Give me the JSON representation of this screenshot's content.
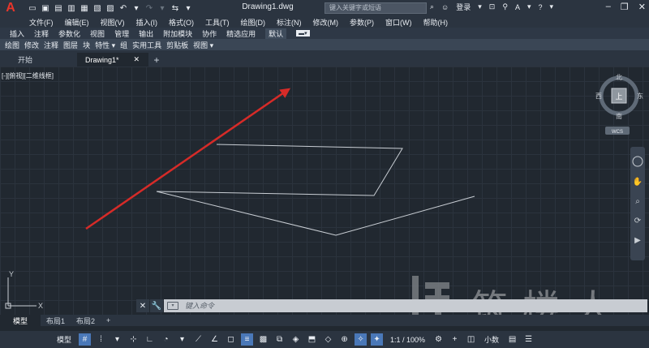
{
  "app": {
    "logo": "A",
    "document_title": "Drawing1.dwg"
  },
  "search": {
    "placeholder": "键入关键字或短语"
  },
  "account": {
    "sign_in": "登录"
  },
  "menu": [
    "文件(F)",
    "编辑(E)",
    "视图(V)",
    "插入(I)",
    "格式(O)",
    "工具(T)",
    "绘图(D)",
    "标注(N)",
    "修改(M)",
    "参数(P)",
    "窗口(W)",
    "帮助(H)"
  ],
  "ribbon_tabs": [
    "插入",
    "注释",
    "参数化",
    "视图",
    "管理",
    "输出",
    "附加模块",
    "协作",
    "精选应用",
    "默认"
  ],
  "ribbon_active": "默认",
  "panels": [
    "绘图",
    "修改",
    "注释",
    "图层",
    "块",
    "特性 ▾",
    "组",
    "实用工具",
    "剪贴板",
    "视图 ▾"
  ],
  "file_tabs": {
    "start": "开始",
    "active": "Drawing1*"
  },
  "viewport": {
    "label": "[-][俯视][二维线框]"
  },
  "viewcube": {
    "north": "北",
    "south": "南",
    "east": "东",
    "west": "西",
    "top": "上",
    "ucs": "WCS"
  },
  "ucs_icon": {
    "x": "X",
    "y": "Y"
  },
  "command": {
    "placeholder": "键入命令"
  },
  "layout_tabs": [
    "模型",
    "布局1",
    "布局2"
  ],
  "status": {
    "model": "模型",
    "scale": "1:1 / 100%",
    "units": "小数"
  },
  "watermark": {
    "text": "筑楼人"
  },
  "colors": {
    "accent": "#e8362b",
    "canvas": "#212830",
    "arrow": "#d62b28"
  }
}
